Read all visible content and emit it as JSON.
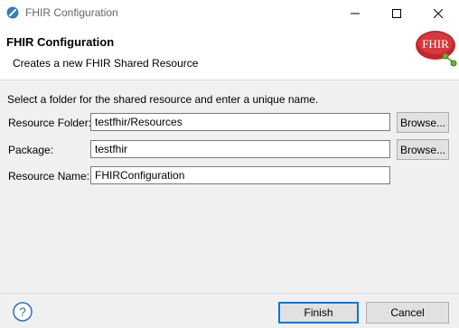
{
  "window": {
    "title": "FHIR Configuration"
  },
  "banner": {
    "title": "FHIR Configuration",
    "description": "Creates a new FHIR Shared Resource",
    "logo_text": "FHIR"
  },
  "form": {
    "instructions": "Select a folder for the shared resource and enter a unique name.",
    "resource_folder": {
      "label": "Resource Folder:",
      "value": "testfhir/Resources",
      "browse_label": "Browse..."
    },
    "package": {
      "label": "Package:",
      "value": "testfhir",
      "browse_label": "Browse..."
    },
    "resource_name": {
      "label": "Resource Name:",
      "value": "FHIRConfiguration"
    }
  },
  "footer": {
    "finish_label": "Finish",
    "cancel_label": "Cancel"
  },
  "colors": {
    "accent": "#0078d7",
    "logo_red": "#c0282d",
    "logo_green": "#6cb33f"
  },
  "icons": [
    "app-icon",
    "minimize-icon",
    "maximize-icon",
    "close-icon",
    "fhir-logo",
    "help-icon"
  ]
}
